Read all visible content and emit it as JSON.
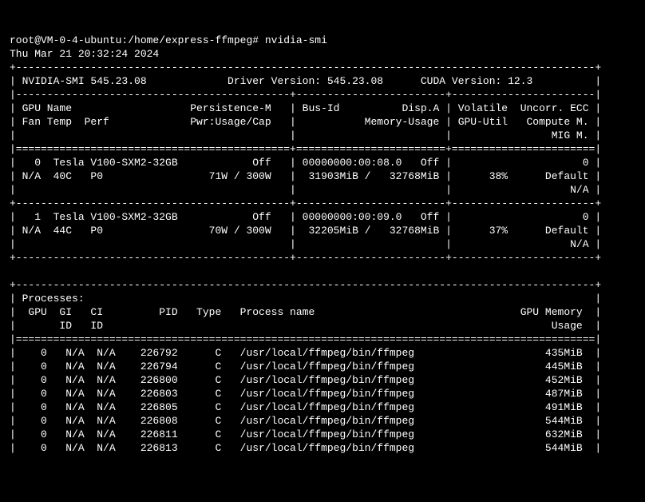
{
  "prompt": "root@VM-0-4-ubuntu:/home/express-ffmpeg# nvidia-smi",
  "date": "Thu Mar 21 20:32:24 2024",
  "nvidia_smi_version": "545.23.08",
  "driver_version": "545.23.08",
  "cuda_version": "12.3",
  "header": {
    "col_gpu": "GPU",
    "col_name": "Name",
    "col_persistence": "Persistence-M",
    "col_fan": "Fan",
    "col_temp": "Temp",
    "col_perf": "Perf",
    "col_pwr": "Pwr:Usage/Cap",
    "col_busid": "Bus-Id",
    "col_dispa": "Disp.A",
    "col_memusage": "Memory-Usage",
    "col_volatile": "Volatile",
    "col_uncorr_ecc": "Uncorr. ECC",
    "col_gpuutil": "GPU-Util",
    "col_computem": "Compute M.",
    "col_migm": "MIG M."
  },
  "gpus": [
    {
      "index": "0",
      "name": "Tesla V100-SXM2-32GB",
      "persistence": "Off",
      "fan": "N/A",
      "temp": "40C",
      "perf": "P0",
      "pwr": "71W / 300W",
      "busid": "00000000:00:08.0",
      "dispa": "Off",
      "mem_used": "31903MiB",
      "mem_total": "32768MiB",
      "gpu_util": "38%",
      "uncorr_ecc": "0",
      "compute_m": "Default",
      "mig_m": "N/A"
    },
    {
      "index": "1",
      "name": "Tesla V100-SXM2-32GB",
      "persistence": "Off",
      "fan": "N/A",
      "temp": "44C",
      "perf": "P0",
      "pwr": "70W / 300W",
      "busid": "00000000:00:09.0",
      "dispa": "Off",
      "mem_used": "32205MiB",
      "mem_total": "32768MiB",
      "gpu_util": "37%",
      "uncorr_ecc": "0",
      "compute_m": "Default",
      "mig_m": "N/A"
    }
  ],
  "processes_header": {
    "title": "Processes:",
    "col_gpu": "GPU",
    "col_gi": "GI",
    "col_ci": "CI",
    "col_pid": "PID",
    "col_type": "Type",
    "col_pname": "Process name",
    "col_gpumem": "GPU Memory",
    "col_id": "ID",
    "col_usage": "Usage"
  },
  "processes": [
    {
      "gpu": "0",
      "gi": "N/A",
      "ci": "N/A",
      "pid": "226792",
      "type": "C",
      "pname": "/usr/local/ffmpeg/bin/ffmpeg",
      "mem": "435MiB"
    },
    {
      "gpu": "0",
      "gi": "N/A",
      "ci": "N/A",
      "pid": "226794",
      "type": "C",
      "pname": "/usr/local/ffmpeg/bin/ffmpeg",
      "mem": "445MiB"
    },
    {
      "gpu": "0",
      "gi": "N/A",
      "ci": "N/A",
      "pid": "226800",
      "type": "C",
      "pname": "/usr/local/ffmpeg/bin/ffmpeg",
      "mem": "452MiB"
    },
    {
      "gpu": "0",
      "gi": "N/A",
      "ci": "N/A",
      "pid": "226803",
      "type": "C",
      "pname": "/usr/local/ffmpeg/bin/ffmpeg",
      "mem": "487MiB"
    },
    {
      "gpu": "0",
      "gi": "N/A",
      "ci": "N/A",
      "pid": "226805",
      "type": "C",
      "pname": "/usr/local/ffmpeg/bin/ffmpeg",
      "mem": "491MiB"
    },
    {
      "gpu": "0",
      "gi": "N/A",
      "ci": "N/A",
      "pid": "226808",
      "type": "C",
      "pname": "/usr/local/ffmpeg/bin/ffmpeg",
      "mem": "544MiB"
    },
    {
      "gpu": "0",
      "gi": "N/A",
      "ci": "N/A",
      "pid": "226811",
      "type": "C",
      "pname": "/usr/local/ffmpeg/bin/ffmpeg",
      "mem": "632MiB"
    },
    {
      "gpu": "0",
      "gi": "N/A",
      "ci": "N/A",
      "pid": "226813",
      "type": "C",
      "pname": "/usr/local/ffmpeg/bin/ffmpeg",
      "mem": "544MiB"
    }
  ]
}
